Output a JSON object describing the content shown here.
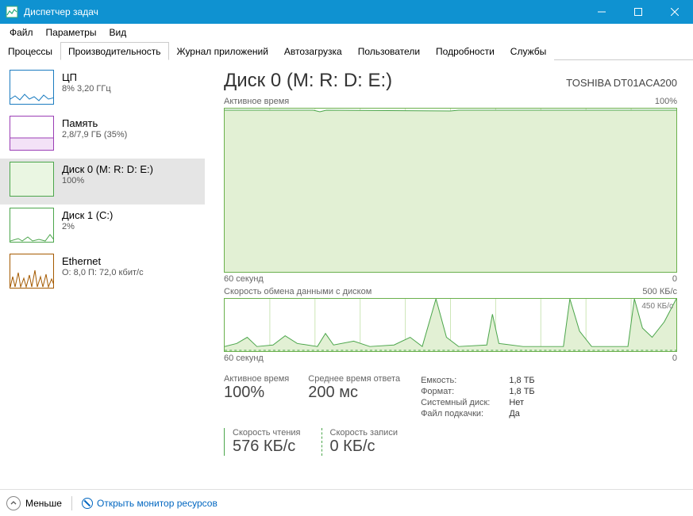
{
  "window": {
    "title": "Диспетчер задач"
  },
  "menu": {
    "file": "Файл",
    "options": "Параметры",
    "view": "Вид"
  },
  "tabs": {
    "processes": "Процессы",
    "performance": "Производительность",
    "apphistory": "Журнал приложений",
    "startup": "Автозагрузка",
    "users": "Пользователи",
    "details": "Подробности",
    "services": "Службы"
  },
  "sidebar": {
    "cpu": {
      "title": "ЦП",
      "sub": "8%  3,20 ГГц"
    },
    "mem": {
      "title": "Память",
      "sub": "2,8/7,9 ГБ (35%)"
    },
    "disk0": {
      "title": "Диск 0 (M: R: D: E:)",
      "sub": "100%"
    },
    "disk1": {
      "title": "Диск 1 (C:)",
      "sub": "2%"
    },
    "eth": {
      "title": "Ethernet",
      "sub": "О: 8,0  П: 72,0 кбит/с"
    }
  },
  "detail": {
    "title": "Диск 0 (M: R: D: E:)",
    "model": "TOSHIBA DT01ACA200",
    "graph1": {
      "label": "Активное время",
      "max": "100%",
      "xleft": "60 секунд",
      "xright": "0"
    },
    "graph2": {
      "label": "Скорость обмена данными с диском",
      "max": "500 КБ/с",
      "inline": "450 КБ/с",
      "xleft": "60 секунд",
      "xright": "0"
    },
    "stats": {
      "active_label": "Активное время",
      "active_val": "100%",
      "resp_label": "Среднее время ответа",
      "resp_val": "200 мс",
      "read_label": "Скорость чтения",
      "read_val": "576 КБ/с",
      "write_label": "Скорость записи",
      "write_val": "0 КБ/с"
    },
    "info": {
      "capacity_l": "Емкость:",
      "capacity_v": "1,8 ТБ",
      "formatted_l": "Формат:",
      "formatted_v": "1,8 ТБ",
      "sysdisk_l": "Системный диск:",
      "sysdisk_v": "Нет",
      "pagefile_l": "Файл подкачки:",
      "pagefile_v": "Да"
    }
  },
  "footer": {
    "fewer": "Меньше",
    "resmon": "Открыть монитор ресурсов"
  },
  "chart_data": [
    {
      "type": "area",
      "title": "Активное время",
      "ylabel": "%",
      "ylim": [
        0,
        100
      ],
      "xlabel": "секунд",
      "xlim": [
        60,
        0
      ],
      "series": [
        {
          "name": "Активное время",
          "values": [
            100,
            100,
            100,
            100,
            100,
            100,
            100,
            100,
            100,
            100,
            100,
            100,
            99,
            100,
            100,
            100,
            100,
            100,
            100,
            100,
            100,
            100,
            100,
            100,
            100,
            100,
            100,
            100,
            100,
            100,
            100,
            100,
            100,
            100,
            100,
            100,
            100,
            100,
            100,
            100,
            100,
            100,
            100,
            100,
            100,
            100,
            100,
            100,
            100,
            100,
            100,
            100,
            100,
            100,
            100,
            100,
            100,
            100,
            100,
            100
          ]
        }
      ]
    },
    {
      "type": "line",
      "title": "Скорость обмена данными с диском",
      "ylabel": "КБ/с",
      "ylim": [
        0,
        500
      ],
      "xlabel": "секунд",
      "xlim": [
        60,
        0
      ],
      "series": [
        {
          "name": "Чтение",
          "values": [
            40,
            50,
            60,
            30,
            30,
            30,
            50,
            90,
            60,
            40,
            30,
            30,
            30,
            120,
            80,
            40,
            30,
            60,
            40,
            30,
            30,
            30,
            30,
            50,
            80,
            40,
            30,
            30,
            450,
            110,
            40,
            30,
            30,
            30,
            30,
            320,
            60,
            40,
            30,
            30,
            30,
            30,
            30,
            30,
            30,
            450,
            200,
            60,
            30,
            30,
            30,
            30,
            30,
            30,
            450,
            230,
            110,
            150,
            300,
            500
          ]
        },
        {
          "name": "Запись",
          "values": [
            0,
            0,
            0,
            0,
            0,
            0,
            0,
            0,
            0,
            0,
            0,
            0,
            0,
            0,
            0,
            0,
            0,
            0,
            0,
            0,
            0,
            0,
            0,
            0,
            0,
            0,
            0,
            0,
            0,
            0,
            0,
            0,
            0,
            0,
            0,
            0,
            0,
            0,
            0,
            0,
            0,
            0,
            0,
            0,
            0,
            0,
            0,
            0,
            0,
            0,
            0,
            0,
            0,
            0,
            0,
            0,
            0,
            0,
            0,
            0
          ]
        }
      ]
    }
  ]
}
